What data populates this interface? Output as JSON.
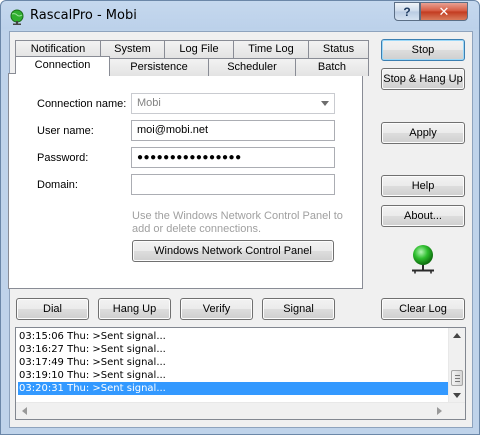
{
  "window": {
    "title": "RascalPro - Mobi",
    "help_glyph": "?",
    "close_glyph": "✕"
  },
  "tabs": {
    "row1": [
      "Notification",
      "System",
      "Log File",
      "Time Log",
      "Status"
    ],
    "row2": [
      "Connection",
      "Persistence",
      "Scheduler",
      "Batch"
    ],
    "active": "Connection"
  },
  "form": {
    "connection_name_label": "Connection name:",
    "connection_name_value": "Mobi",
    "user_name_label": "User name:",
    "user_name_value": "moi@mobi.net",
    "password_label": "Password:",
    "password_value": "●●●●●●●●●●●●●●●●",
    "domain_label": "Domain:",
    "domain_value": "",
    "hint_line1": "Use the Windows Network Control Panel to",
    "hint_line2": "add or delete connections.",
    "network_panel_button": "Windows Network Control Panel"
  },
  "side_buttons": {
    "stop": "Stop",
    "stop_hangup": "Stop & Hang Up",
    "apply": "Apply",
    "help": "Help",
    "about": "About..."
  },
  "action_buttons": {
    "dial": "Dial",
    "hang_up": "Hang Up",
    "verify": "Verify",
    "signal": "Signal",
    "clear_log": "Clear Log"
  },
  "log": {
    "lines": [
      "03:15:06 Thu: >Sent signal...",
      "03:16:27 Thu: >Sent signal...",
      "03:17:49 Thu: >Sent signal...",
      "03:19:10 Thu: >Sent signal...",
      "03:20:31 Thu: >Sent signal..."
    ],
    "selected_index": 4
  },
  "colors": {
    "selection": "#3399ff",
    "globe": "#22a822"
  },
  "icons": {
    "app": "globe-icon",
    "status": "globe-network-icon"
  }
}
